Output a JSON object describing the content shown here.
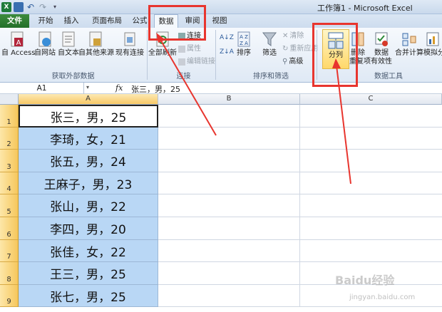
{
  "window": {
    "title": "工作簿1 - Microsoft Excel"
  },
  "tabs": [
    "文件",
    "开始",
    "插入",
    "页面布局",
    "公式",
    "数据",
    "审阅",
    "视图"
  ],
  "ribbon": {
    "get_external": {
      "access": "自 Access",
      "web": "自网站",
      "text": "自文本",
      "other": "自其他来源",
      "existing": "现有连接",
      "group": "获取外部数据"
    },
    "connections": {
      "refresh_all": "全部刷新",
      "connections": "连接",
      "properties": "属性",
      "edit_links": "编辑链接",
      "group": "连接"
    },
    "sort_filter": {
      "sort": "排序",
      "filter": "筛选",
      "clear": "清除",
      "reapply": "重新应用",
      "advanced": "高级",
      "group": "排序和筛选"
    },
    "data_tools": {
      "text_to_columns": "分列",
      "remove_dup": "删除",
      "remove_dup2": "重复项",
      "validation": "数据",
      "validation2": "有效性",
      "consolidate": "合并计算",
      "whatif": "模拟分",
      "group": "数据工具"
    }
  },
  "formula_bar": {
    "name_box": "A1",
    "fx": "fx",
    "value": "张三，男，25"
  },
  "columns": [
    "A",
    "B",
    "C"
  ],
  "rows": [
    {
      "num": "1",
      "a": "张三，男，25"
    },
    {
      "num": "2",
      "a": "李琦，女，21"
    },
    {
      "num": "3",
      "a": "张五，男，24"
    },
    {
      "num": "4",
      "a": "王麻子，男，23"
    },
    {
      "num": "5",
      "a": "张山，男，22"
    },
    {
      "num": "6",
      "a": "李四，男，20"
    },
    {
      "num": "7",
      "a": "张佳，女，22"
    },
    {
      "num": "8",
      "a": "王三，男，25"
    },
    {
      "num": "9",
      "a": "张七，男，25"
    }
  ],
  "watermark": {
    "main": "Baidu经验",
    "url": "jingyan.baidu.com"
  },
  "colors": {
    "highlight": "#e8352e",
    "selection": "#b9d7f5",
    "file_tab": "#2e7d32"
  }
}
